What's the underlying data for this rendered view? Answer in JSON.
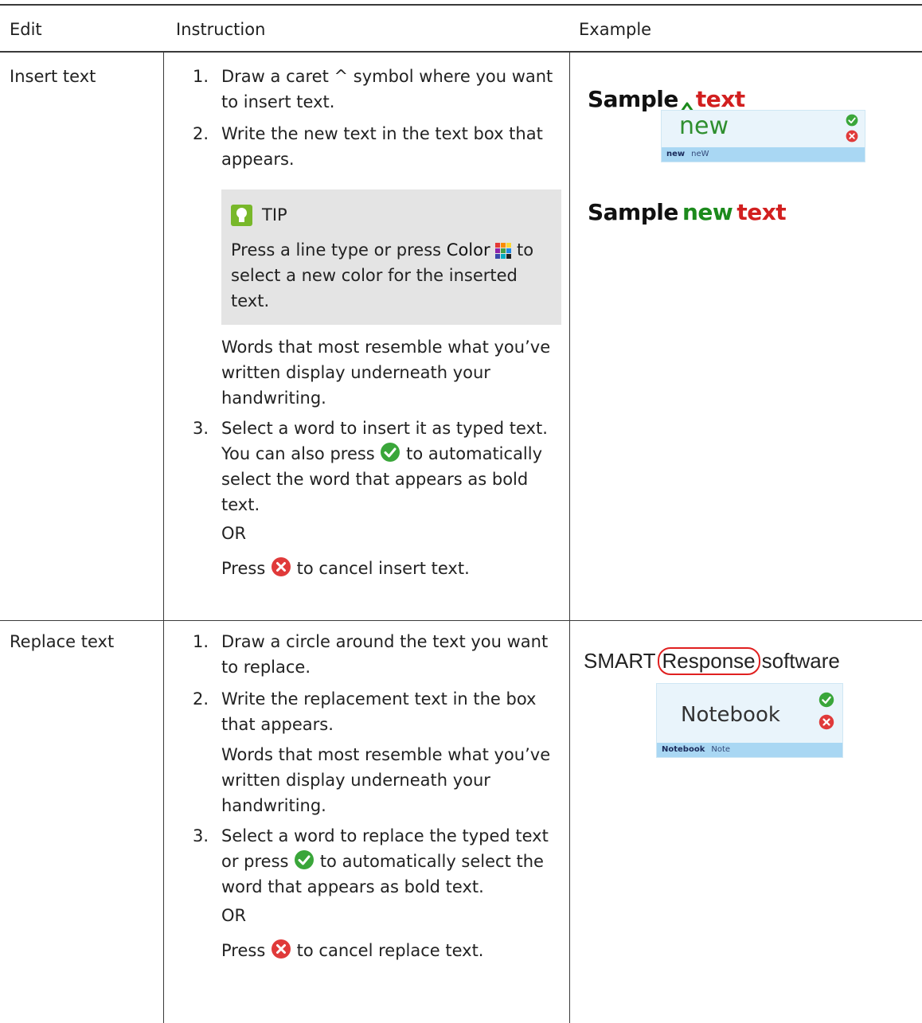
{
  "table": {
    "headers": {
      "edit": "Edit",
      "instruction": "Instruction",
      "example": "Example"
    },
    "rows": [
      {
        "edit": "Insert text",
        "steps": [
          {
            "num": "1.",
            "text": "Draw a caret ^ symbol where you want to insert text."
          },
          {
            "num": "2.",
            "text": "Write the new text in the text box that appears."
          }
        ],
        "tip": {
          "title": "TIP",
          "text_before": "Press a line type or press ",
          "bold": "Color",
          "text_after": " to select a new color for the inserted text."
        },
        "note": "Words that most resemble what you’ve written display underneath your handwriting.",
        "step3": {
          "num": "3.",
          "text_before": "Select a word to insert it as typed text. You can also press ",
          "text_after": " to automatically select the word that appears as bold text."
        },
        "or": "OR",
        "cancel_before": "Press ",
        "cancel_after": " to cancel insert text.",
        "example": {
          "sample_word": "Sample",
          "text_word": "text",
          "handwritten": "new",
          "suggestions": [
            "new",
            "neW"
          ],
          "result": [
            "Sample",
            "new",
            "text"
          ]
        }
      },
      {
        "edit": "Replace text",
        "steps": [
          {
            "num": "1.",
            "text": "Draw a circle around the text you want to replace."
          },
          {
            "num": "2.",
            "text": "Write the replacement text in the box that appears."
          }
        ],
        "note": "Words that most resemble what you’ve written display underneath your handwriting.",
        "step3": {
          "num": "3.",
          "text_before": "Select a word to replace the typed text or press ",
          "text_after": " to automatically select the word that appears as bold text."
        },
        "or": "OR",
        "cancel_before": "Press ",
        "cancel_after": " to cancel replace text.",
        "example": {
          "before": "SMART",
          "circled": "Response",
          "after": "software",
          "handwritten": "Notebook",
          "suggestions": [
            "Notebook",
            "Note"
          ]
        }
      }
    ]
  },
  "colors": {
    "accept": "#3aa63a",
    "cancel": "#e03a3a",
    "tip_bg": "#e4e4e4",
    "tip_icon": "#78b82a",
    "sample_black": "#111111",
    "sample_red": "#d21f1f",
    "sample_green": "#1c8a1c",
    "popup_bar": "#a9d7f3"
  },
  "icons": {
    "accept": "check-circle-icon",
    "cancel": "x-circle-icon",
    "color": "color-palette-icon",
    "tip": "lightbulb-icon"
  }
}
